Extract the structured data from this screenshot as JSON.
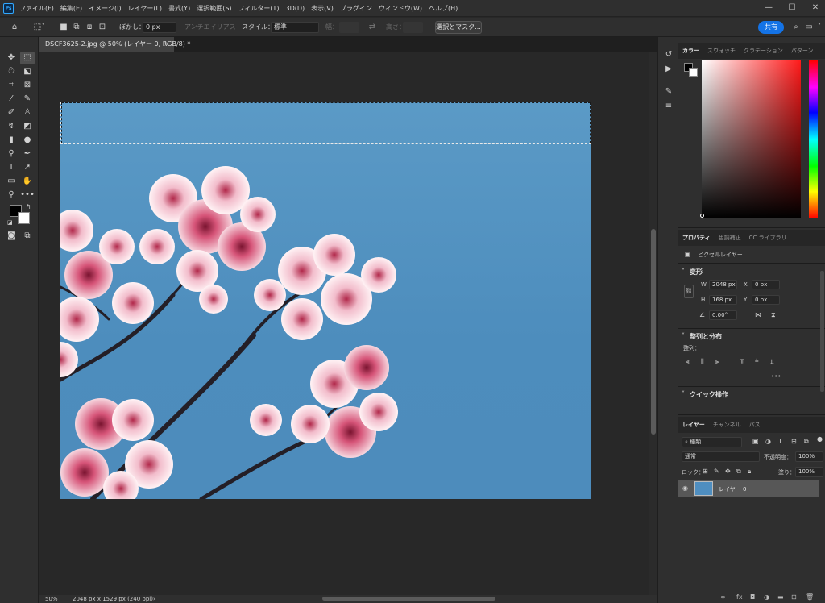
{
  "app": {
    "logo": "Ps"
  },
  "menubar": {
    "items": [
      "ファイル(F)",
      "編集(E)",
      "イメージ(I)",
      "レイヤー(L)",
      "書式(Y)",
      "選択範囲(S)",
      "フィルター(T)",
      "3D(D)",
      "表示(V)",
      "プラグイン",
      "ウィンドウ(W)",
      "ヘルプ(H)"
    ],
    "window_buttons": {
      "minimize": "—",
      "maximize": "☐",
      "close": "✕"
    }
  },
  "options": {
    "feather_label": "ぼかし：",
    "feather_value": "0 px",
    "antialias_label": "アンチエイリアス",
    "style_label": "スタイル：",
    "style_value": "標準",
    "width_label": "幅：",
    "height_label": "高さ：",
    "select_mask_button": "選択とマスク...",
    "share_button": "共有"
  },
  "document": {
    "tab_title": "DSCF3625-2.jpg @ 50% (レイヤー 0, RGB/8) *",
    "tab_close": "×"
  },
  "status": {
    "zoom": "50%",
    "info": "2048 px x 1529 px (240 ppi)",
    "arrow": "›"
  },
  "color_panel": {
    "tabs": [
      "カラー",
      "スウォッチ",
      "グラデーション",
      "パターン"
    ],
    "foreground": "#000000",
    "background": "#ffffff"
  },
  "properties": {
    "tabs": [
      "プロパティ",
      "色調補正",
      "CC ライブラリ"
    ],
    "layer_type": "ピクセルレイヤー",
    "transform_title": "変形",
    "w_label": "W",
    "w_value": "2048 px",
    "x_label": "X",
    "x_value": "0 px",
    "h_label": "H",
    "h_value": "168 px",
    "y_label": "Y",
    "y_value": "0 px",
    "angle_value": "0.00°",
    "align_title": "整列と分布",
    "align_label": "整列：",
    "more": "•••",
    "quick_title": "クイック操作"
  },
  "layers_panel": {
    "tabs": [
      "レイヤー",
      "チャンネル",
      "パス"
    ],
    "filter_label": "種類",
    "blend_mode": "通常",
    "opacity_label": "不透明度：",
    "opacity_value": "100%",
    "lock_label": "ロック：",
    "fill_label": "塗り：",
    "fill_value": "100%",
    "layers": [
      {
        "name": "レイヤー 0",
        "visible": true
      }
    ]
  }
}
